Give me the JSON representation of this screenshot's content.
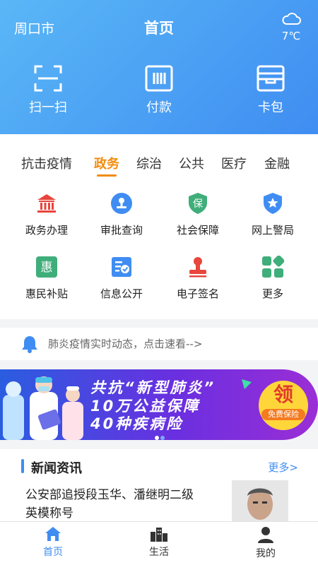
{
  "header": {
    "city": "周口市",
    "title": "首页",
    "weather": {
      "icon": "cloud-icon",
      "temperature": "7℃"
    },
    "quick_actions": [
      {
        "label": "扫一扫",
        "icon": "scan-icon"
      },
      {
        "label": "付款",
        "icon": "barcode-icon"
      },
      {
        "label": "卡包",
        "icon": "wallet-icon"
      }
    ]
  },
  "tabs": [
    {
      "label": "抗击疫情"
    },
    {
      "label": "政务",
      "active": true
    },
    {
      "label": "综治"
    },
    {
      "label": "公共"
    },
    {
      "label": "医疗"
    },
    {
      "label": "金融"
    }
  ],
  "services": [
    {
      "label": "政务办理",
      "icon": "government-building-icon",
      "color": "#e8453c"
    },
    {
      "label": "审批查询",
      "icon": "approval-stamp-icon",
      "color": "#3f8df2"
    },
    {
      "label": "社会保障",
      "icon": "shield-icon",
      "shield_text": "保",
      "color": "#3fae7a"
    },
    {
      "label": "网上警局",
      "icon": "police-badge-icon",
      "color": "#3f8df2"
    },
    {
      "label": "惠民补贴",
      "icon": "subsidy-icon",
      "icon_text": "惠",
      "color": "#3fae7a"
    },
    {
      "label": "信息公开",
      "icon": "info-document-icon",
      "color": "#3f8df2"
    },
    {
      "label": "电子签名",
      "icon": "seal-icon",
      "color": "#e8453c"
    },
    {
      "label": "更多",
      "icon": "more-grid-icon",
      "color": "#3fae7a"
    }
  ],
  "notice": {
    "icon": "bell-icon",
    "text": "肺炎疫情实时动态，点击速看-->"
  },
  "banner": {
    "line1": "共抗“新型肺炎”",
    "line2": "10万公益保障",
    "line3": "40种疾病险",
    "badge_big": "领",
    "badge_small": "免费保险",
    "active_slide": 1,
    "slide_count": 2
  },
  "news": {
    "title": "新闻资讯",
    "more": "更多>",
    "items": [
      {
        "headline": "公安部追授段玉华、潘继明二级英模称号",
        "image": "portrait-photo"
      }
    ]
  },
  "tabbar": [
    {
      "label": "首页",
      "icon": "home-icon",
      "active": true
    },
    {
      "label": "生活",
      "icon": "city-icon"
    },
    {
      "label": "我的",
      "icon": "user-icon"
    }
  ],
  "colors": {
    "primary": "#3f8df2",
    "accent": "#f28c0e"
  }
}
